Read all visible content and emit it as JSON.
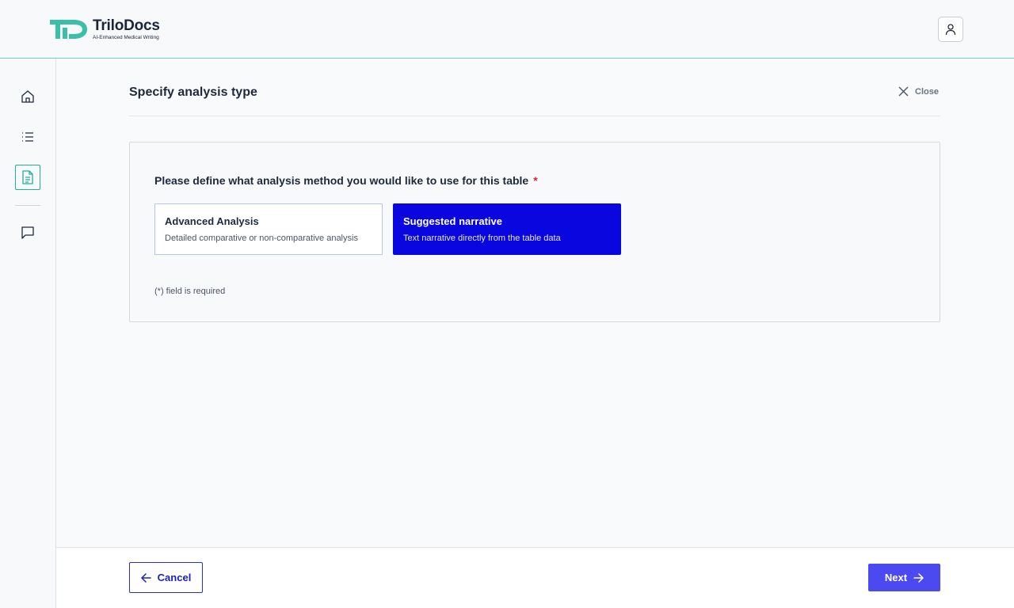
{
  "app": {
    "name": "TriloDocs",
    "tagline": "AI-Enhanced Medical Writing",
    "colors": {
      "brand_teal": "#2ba896",
      "primary_blue": "#0a06e0",
      "next_button": "#4a4af0",
      "required": "#e0212f"
    }
  },
  "header": {
    "user_icon": "user-icon"
  },
  "sidebar": {
    "items": [
      {
        "id": "home",
        "icon": "home-icon",
        "active": false
      },
      {
        "id": "list",
        "icon": "list-icon",
        "active": false
      },
      {
        "id": "document",
        "icon": "document-icon",
        "active": true
      },
      {
        "id": "chat",
        "icon": "chat-icon",
        "active": false
      }
    ]
  },
  "main": {
    "title": "Specify analysis type",
    "close_label": "Close",
    "question": "Please define what analysis method you would like to use for this table",
    "required_mark": "*",
    "options": [
      {
        "title": "Advanced Analysis",
        "description": "Detailed comparative or non-comparative analysis",
        "selected": false
      },
      {
        "title": "Suggested narrative",
        "description": "Text narrative directly from the table data",
        "selected": true
      }
    ],
    "required_note": "(*) field is required"
  },
  "footer": {
    "cancel_label": "Cancel",
    "next_label": "Next"
  }
}
